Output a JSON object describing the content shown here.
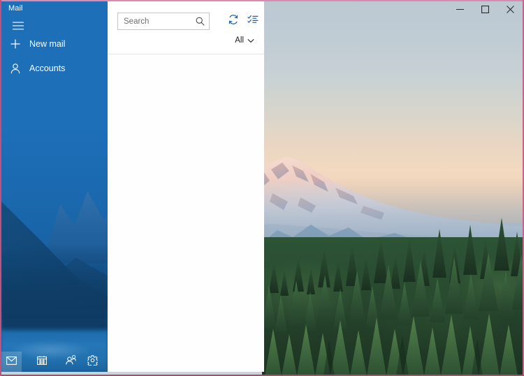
{
  "window": {
    "app_title": "Mail",
    "controls": [
      {
        "name": "minimize",
        "glyph": "minimize-icon"
      },
      {
        "name": "maximize",
        "glyph": "maximize-icon"
      },
      {
        "name": "close",
        "glyph": "close-icon"
      }
    ],
    "accent_color": "#1d6fb8",
    "border_color": "#c0527f"
  },
  "sidebar": {
    "title": "Mail",
    "hamburger_icon": "hamburger-menu-icon",
    "items": [
      {
        "label": "New mail",
        "icon": "plus-icon"
      },
      {
        "label": "Accounts",
        "icon": "person-icon"
      }
    ],
    "bottom_bar": [
      {
        "name": "mail",
        "icon": "envelope-icon",
        "active": true
      },
      {
        "name": "calendar",
        "icon": "calendar-icon",
        "active": false
      },
      {
        "name": "people",
        "icon": "people-icon",
        "active": false
      },
      {
        "name": "settings",
        "icon": "gear-icon",
        "active": false
      }
    ]
  },
  "message_list": {
    "search": {
      "placeholder": "Search",
      "value": "",
      "icon": "search-icon"
    },
    "toolbar": [
      {
        "name": "sync",
        "icon": "sync-icon"
      },
      {
        "name": "selection-mode",
        "icon": "selection-list-icon"
      }
    ],
    "filter": {
      "label": "All",
      "icon": "chevron-down-icon"
    },
    "messages": []
  },
  "desktop": {
    "wallpaper_name": "mount-rainier-sunset",
    "sky_top_color": "#bcc9d2",
    "sky_horizon_color": "#f2d9c0",
    "forest_color": "#2a4d31"
  }
}
